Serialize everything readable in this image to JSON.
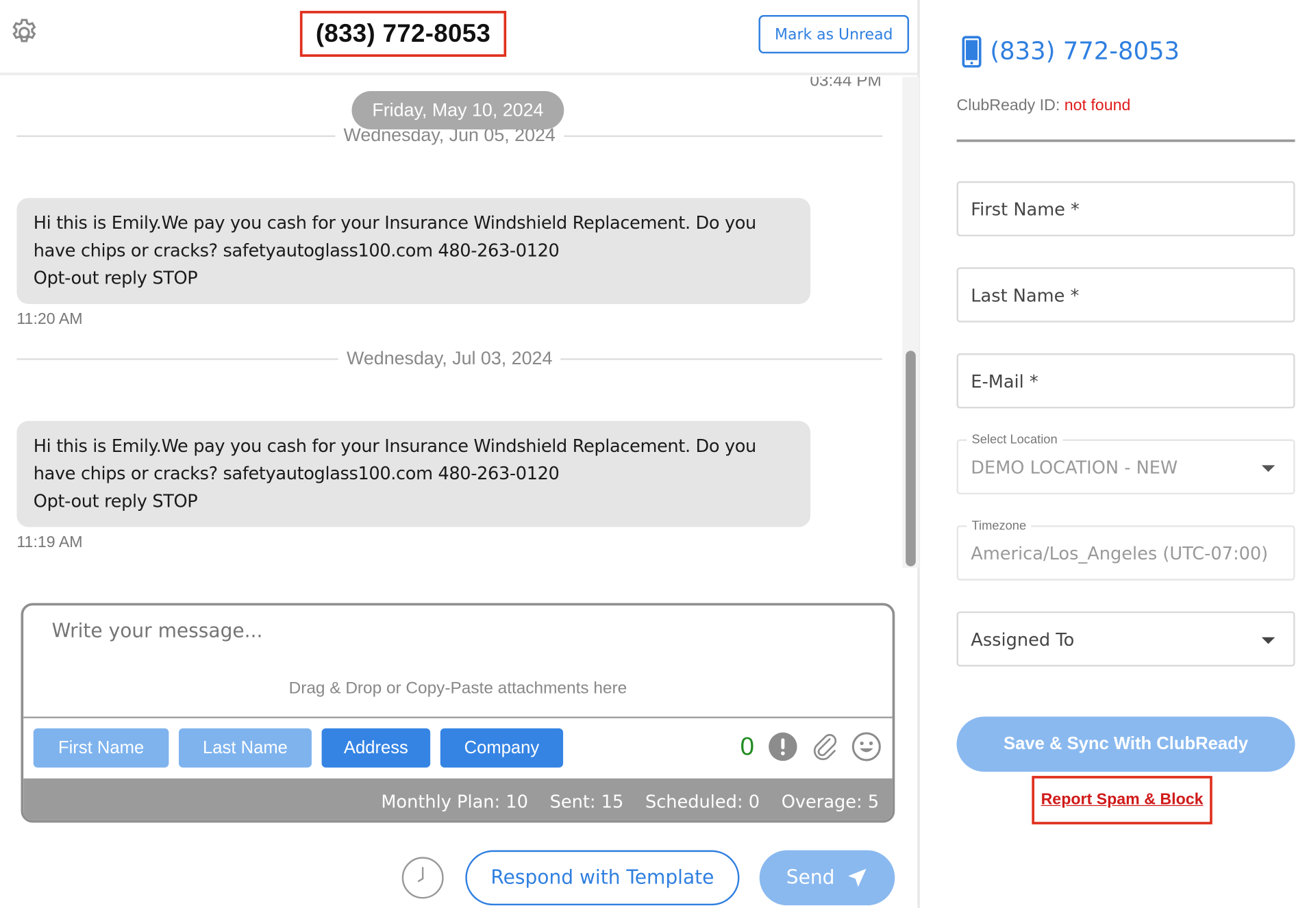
{
  "header": {
    "title": "(833) 772-8053",
    "mark_unread_label": "Mark as Unread"
  },
  "thread": {
    "top_time": "03:44 PM",
    "floating_date_pill": "Friday, May 10, 2024",
    "dividers": [
      "Wednesday, Jun 05, 2024",
      "Wednesday, Jul 03, 2024"
    ],
    "messages": [
      {
        "lines": [
          "Hi this is Emily.We pay you cash for your Insurance Windshield Replacement. Do you",
          "have chips or cracks? safetyautoglass100.com 480-263-0120",
          "Opt-out reply STOP"
        ],
        "time": "11:20 AM"
      },
      {
        "lines": [
          "Hi this is Emily.We pay you cash for your Insurance Windshield Replacement. Do you",
          "have chips or cracks? safetyautoglass100.com 480-263-0120",
          "Opt-out reply STOP"
        ],
        "time": "11:19 AM"
      }
    ]
  },
  "composer": {
    "placeholder": "Write your message...",
    "drop_hint": "Drag & Drop or Copy-Paste attachments here",
    "chips": [
      "First Name",
      "Last Name",
      "Address",
      "Company"
    ],
    "char_count": "0",
    "plan": {
      "monthly": "Monthly Plan: 10",
      "sent": "Sent: 15",
      "scheduled": "Scheduled: 0",
      "overage": "Overage: 5"
    }
  },
  "actions": {
    "respond_template": "Respond with Template",
    "send": "Send"
  },
  "contact": {
    "phone": "(833) 772-8053",
    "clubready_label": "ClubReady ID:",
    "clubready_value": "not found",
    "first_name_ph": "First Name *",
    "last_name_ph": "Last Name *",
    "email_ph": "E-Mail *",
    "location_label": "Select Location",
    "location_value": "DEMO LOCATION - NEW",
    "timezone_label": "Timezone",
    "timezone_value": "America/Los_Angeles (UTC-07:00)",
    "assigned_ph": "Assigned To",
    "save_label": "Save & Sync With ClubReady",
    "spam_label": "Report Spam & Block"
  },
  "colors": {
    "accent": "#2f7fe0",
    "chip_light": "#7eb3ee",
    "chip_dark": "#3584e4",
    "highlight_box": "#e0301e",
    "error_text": "#e01b1b"
  }
}
